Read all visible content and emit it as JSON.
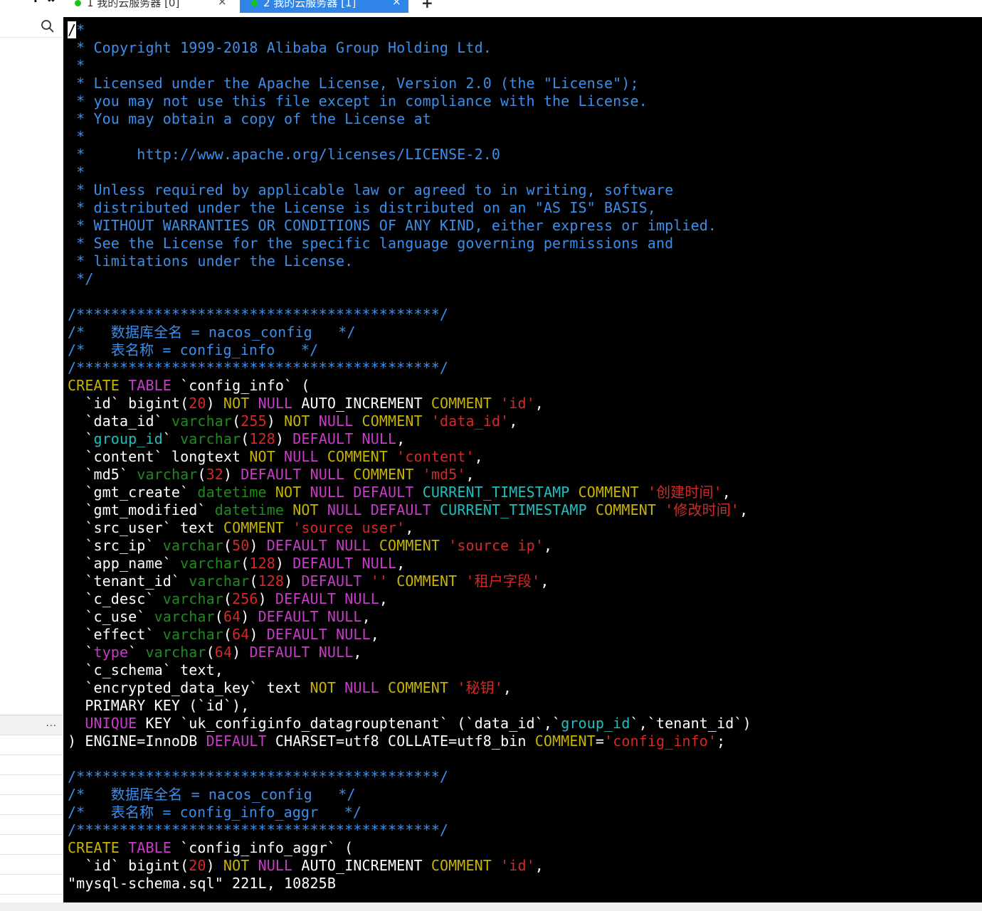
{
  "colors": {
    "comment": "#3b8eea",
    "keyword": "#c8b400",
    "type": "#c83cc8",
    "string": "#d62828",
    "number": "#d62828",
    "datatype": "#1f8a1f",
    "ident": "#1fbfbf",
    "plain": "#ffffff"
  },
  "sidebar": {
    "search_icon": "search-icon",
    "more_label": "..."
  },
  "tabs": [
    {
      "label": "1 我的云服务器 [0]",
      "close": "×",
      "status": "connected"
    },
    {
      "label": "2 我的云服务器 [1]",
      "close": "×",
      "status": "connected"
    }
  ],
  "tab_add_label": "+",
  "editor": {
    "status_line": "\"mysql-schema.sql\" 221L, 10825B",
    "lines": [
      [
        [
          "cursor",
          "/"
        ],
        [
          "comment",
          "*"
        ]
      ],
      [
        [
          "comment",
          " * Copyright 1999-2018 Alibaba Group Holding Ltd."
        ]
      ],
      [
        [
          "comment",
          " *"
        ]
      ],
      [
        [
          "comment",
          " * Licensed under the Apache License, Version 2.0 (the \"License\");"
        ]
      ],
      [
        [
          "comment",
          " * you may not use this file except in compliance with the License."
        ]
      ],
      [
        [
          "comment",
          " * You may obtain a copy of the License at"
        ]
      ],
      [
        [
          "comment",
          " *"
        ]
      ],
      [
        [
          "comment",
          " *      http://www.apache.org/licenses/LICENSE-2.0"
        ]
      ],
      [
        [
          "comment",
          " *"
        ]
      ],
      [
        [
          "comment",
          " * Unless required by applicable law or agreed to in writing, software"
        ]
      ],
      [
        [
          "comment",
          " * distributed under the License is distributed on an \"AS IS\" BASIS,"
        ]
      ],
      [
        [
          "comment",
          " * WITHOUT WARRANTIES OR CONDITIONS OF ANY KIND, either express or implied."
        ]
      ],
      [
        [
          "comment",
          " * See the License for the specific language governing permissions and"
        ]
      ],
      [
        [
          "comment",
          " * limitations under the License."
        ]
      ],
      [
        [
          "comment",
          " */"
        ]
      ],
      [
        [
          "plain",
          ""
        ]
      ],
      [
        [
          "comment",
          "/******************************************/"
        ]
      ],
      [
        [
          "comment",
          "/*   数据库全名 = nacos_config   */"
        ]
      ],
      [
        [
          "comment",
          "/*   表名称 = config_info   */"
        ]
      ],
      [
        [
          "comment",
          "/******************************************/"
        ]
      ],
      [
        [
          "keyword",
          "CREATE"
        ],
        [
          "plain",
          " "
        ],
        [
          "type",
          "TABLE"
        ],
        [
          "plain",
          " `config_info` ("
        ]
      ],
      [
        [
          "plain",
          "  `id` bigint("
        ],
        [
          "number",
          "20"
        ],
        [
          "plain",
          ") "
        ],
        [
          "keyword",
          "NOT"
        ],
        [
          "plain",
          " "
        ],
        [
          "type",
          "NULL"
        ],
        [
          "plain",
          " AUTO_INCREMENT "
        ],
        [
          "keyword",
          "COMMENT"
        ],
        [
          "plain",
          " "
        ],
        [
          "string",
          "'id'"
        ],
        [
          "plain",
          ","
        ]
      ],
      [
        [
          "plain",
          "  `data_id` "
        ],
        [
          "datatype",
          "varchar"
        ],
        [
          "plain",
          "("
        ],
        [
          "number",
          "255"
        ],
        [
          "plain",
          ") "
        ],
        [
          "keyword",
          "NOT"
        ],
        [
          "plain",
          " "
        ],
        [
          "type",
          "NULL"
        ],
        [
          "plain",
          " "
        ],
        [
          "keyword",
          "COMMENT"
        ],
        [
          "plain",
          " "
        ],
        [
          "string",
          "'data_id'"
        ],
        [
          "plain",
          ","
        ]
      ],
      [
        [
          "plain",
          "  `"
        ],
        [
          "ident",
          "group_id"
        ],
        [
          "plain",
          "` "
        ],
        [
          "datatype",
          "varchar"
        ],
        [
          "plain",
          "("
        ],
        [
          "number",
          "128"
        ],
        [
          "plain",
          ") "
        ],
        [
          "type",
          "DEFAULT"
        ],
        [
          "plain",
          " "
        ],
        [
          "type",
          "NULL"
        ],
        [
          "plain",
          ","
        ]
      ],
      [
        [
          "plain",
          "  `content` longtext "
        ],
        [
          "keyword",
          "NOT"
        ],
        [
          "plain",
          " "
        ],
        [
          "type",
          "NULL"
        ],
        [
          "plain",
          " "
        ],
        [
          "keyword",
          "COMMENT"
        ],
        [
          "plain",
          " "
        ],
        [
          "string",
          "'content'"
        ],
        [
          "plain",
          ","
        ]
      ],
      [
        [
          "plain",
          "  `md5` "
        ],
        [
          "datatype",
          "varchar"
        ],
        [
          "plain",
          "("
        ],
        [
          "number",
          "32"
        ],
        [
          "plain",
          ") "
        ],
        [
          "type",
          "DEFAULT"
        ],
        [
          "plain",
          " "
        ],
        [
          "type",
          "NULL"
        ],
        [
          "plain",
          " "
        ],
        [
          "keyword",
          "COMMENT"
        ],
        [
          "plain",
          " "
        ],
        [
          "string",
          "'md5'"
        ],
        [
          "plain",
          ","
        ]
      ],
      [
        [
          "plain",
          "  `gmt_create` "
        ],
        [
          "datatype",
          "datetime"
        ],
        [
          "plain",
          " "
        ],
        [
          "keyword",
          "NOT"
        ],
        [
          "plain",
          " "
        ],
        [
          "type",
          "NULL"
        ],
        [
          "plain",
          " "
        ],
        [
          "type",
          "DEFAULT"
        ],
        [
          "plain",
          " "
        ],
        [
          "ident",
          "CURRENT_TIMESTAMP"
        ],
        [
          "plain",
          " "
        ],
        [
          "keyword",
          "COMMENT"
        ],
        [
          "plain",
          " "
        ],
        [
          "string",
          "'创建时间'"
        ],
        [
          "plain",
          ","
        ]
      ],
      [
        [
          "plain",
          "  `gmt_modified` "
        ],
        [
          "datatype",
          "datetime"
        ],
        [
          "plain",
          " "
        ],
        [
          "keyword",
          "NOT"
        ],
        [
          "plain",
          " "
        ],
        [
          "type",
          "NULL"
        ],
        [
          "plain",
          " "
        ],
        [
          "type",
          "DEFAULT"
        ],
        [
          "plain",
          " "
        ],
        [
          "ident",
          "CURRENT_TIMESTAMP"
        ],
        [
          "plain",
          " "
        ],
        [
          "keyword",
          "COMMENT"
        ],
        [
          "plain",
          " "
        ],
        [
          "string",
          "'修改时间'"
        ],
        [
          "plain",
          ","
        ]
      ],
      [
        [
          "plain",
          "  `src_user` text "
        ],
        [
          "keyword",
          "COMMENT"
        ],
        [
          "plain",
          " "
        ],
        [
          "string",
          "'source user'"
        ],
        [
          "plain",
          ","
        ]
      ],
      [
        [
          "plain",
          "  `src_ip` "
        ],
        [
          "datatype",
          "varchar"
        ],
        [
          "plain",
          "("
        ],
        [
          "number",
          "50"
        ],
        [
          "plain",
          ") "
        ],
        [
          "type",
          "DEFAULT"
        ],
        [
          "plain",
          " "
        ],
        [
          "type",
          "NULL"
        ],
        [
          "plain",
          " "
        ],
        [
          "keyword",
          "COMMENT"
        ],
        [
          "plain",
          " "
        ],
        [
          "string",
          "'source ip'"
        ],
        [
          "plain",
          ","
        ]
      ],
      [
        [
          "plain",
          "  `app_name` "
        ],
        [
          "datatype",
          "varchar"
        ],
        [
          "plain",
          "("
        ],
        [
          "number",
          "128"
        ],
        [
          "plain",
          ") "
        ],
        [
          "type",
          "DEFAULT"
        ],
        [
          "plain",
          " "
        ],
        [
          "type",
          "NULL"
        ],
        [
          "plain",
          ","
        ]
      ],
      [
        [
          "plain",
          "  `tenant_id` "
        ],
        [
          "datatype",
          "varchar"
        ],
        [
          "plain",
          "("
        ],
        [
          "number",
          "128"
        ],
        [
          "plain",
          ") "
        ],
        [
          "type",
          "DEFAULT"
        ],
        [
          "plain",
          " "
        ],
        [
          "string",
          "''"
        ],
        [
          "plain",
          " "
        ],
        [
          "keyword",
          "COMMENT"
        ],
        [
          "plain",
          " "
        ],
        [
          "string",
          "'租户字段'"
        ],
        [
          "plain",
          ","
        ]
      ],
      [
        [
          "plain",
          "  `c_desc` "
        ],
        [
          "datatype",
          "varchar"
        ],
        [
          "plain",
          "("
        ],
        [
          "number",
          "256"
        ],
        [
          "plain",
          ") "
        ],
        [
          "type",
          "DEFAULT"
        ],
        [
          "plain",
          " "
        ],
        [
          "type",
          "NULL"
        ],
        [
          "plain",
          ","
        ]
      ],
      [
        [
          "plain",
          "  `c_use` "
        ],
        [
          "datatype",
          "varchar"
        ],
        [
          "plain",
          "("
        ],
        [
          "number",
          "64"
        ],
        [
          "plain",
          ") "
        ],
        [
          "type",
          "DEFAULT"
        ],
        [
          "plain",
          " "
        ],
        [
          "type",
          "NULL"
        ],
        [
          "plain",
          ","
        ]
      ],
      [
        [
          "plain",
          "  `effect` "
        ],
        [
          "datatype",
          "varchar"
        ],
        [
          "plain",
          "("
        ],
        [
          "number",
          "64"
        ],
        [
          "plain",
          ") "
        ],
        [
          "type",
          "DEFAULT"
        ],
        [
          "plain",
          " "
        ],
        [
          "type",
          "NULL"
        ],
        [
          "plain",
          ","
        ]
      ],
      [
        [
          "plain",
          "  `"
        ],
        [
          "type",
          "type"
        ],
        [
          "plain",
          "` "
        ],
        [
          "datatype",
          "varchar"
        ],
        [
          "plain",
          "("
        ],
        [
          "number",
          "64"
        ],
        [
          "plain",
          ") "
        ],
        [
          "type",
          "DEFAULT"
        ],
        [
          "plain",
          " "
        ],
        [
          "type",
          "NULL"
        ],
        [
          "plain",
          ","
        ]
      ],
      [
        [
          "plain",
          "  `c_schema` text,"
        ]
      ],
      [
        [
          "plain",
          "  `encrypted_data_key` text "
        ],
        [
          "keyword",
          "NOT"
        ],
        [
          "plain",
          " "
        ],
        [
          "type",
          "NULL"
        ],
        [
          "plain",
          " "
        ],
        [
          "keyword",
          "COMMENT"
        ],
        [
          "plain",
          " "
        ],
        [
          "string",
          "'秘钥'"
        ],
        [
          "plain",
          ","
        ]
      ],
      [
        [
          "plain",
          "  PRIMARY KEY (`id`),"
        ]
      ],
      [
        [
          "plain",
          "  "
        ],
        [
          "type",
          "UNIQUE"
        ],
        [
          "plain",
          " KEY `uk_configinfo_datagrouptenant` (`data_id`,`"
        ],
        [
          "ident",
          "group_id"
        ],
        [
          "plain",
          "`,`tenant_id`)"
        ]
      ],
      [
        [
          "plain",
          ") ENGINE=InnoDB "
        ],
        [
          "type",
          "DEFAULT"
        ],
        [
          "plain",
          " CHARSET=utf8 COLLATE=utf8_bin "
        ],
        [
          "keyword",
          "COMMENT"
        ],
        [
          "plain",
          "="
        ],
        [
          "string",
          "'config_info'"
        ],
        [
          "plain",
          ";"
        ]
      ],
      [
        [
          "plain",
          ""
        ]
      ],
      [
        [
          "comment",
          "/******************************************/"
        ]
      ],
      [
        [
          "comment",
          "/*   数据库全名 = nacos_config   */"
        ]
      ],
      [
        [
          "comment",
          "/*   表名称 = config_info_aggr   */"
        ]
      ],
      [
        [
          "comment",
          "/******************************************/"
        ]
      ],
      [
        [
          "keyword",
          "CREATE"
        ],
        [
          "plain",
          " "
        ],
        [
          "type",
          "TABLE"
        ],
        [
          "plain",
          " `config_info_aggr` ("
        ]
      ],
      [
        [
          "plain",
          "  `id` bigint("
        ],
        [
          "number",
          "20"
        ],
        [
          "plain",
          ") "
        ],
        [
          "keyword",
          "NOT"
        ],
        [
          "plain",
          " "
        ],
        [
          "type",
          "NULL"
        ],
        [
          "plain",
          " AUTO_INCREMENT "
        ],
        [
          "keyword",
          "COMMENT"
        ],
        [
          "plain",
          " "
        ],
        [
          "string",
          "'id'"
        ],
        [
          "plain",
          ","
        ]
      ]
    ]
  }
}
